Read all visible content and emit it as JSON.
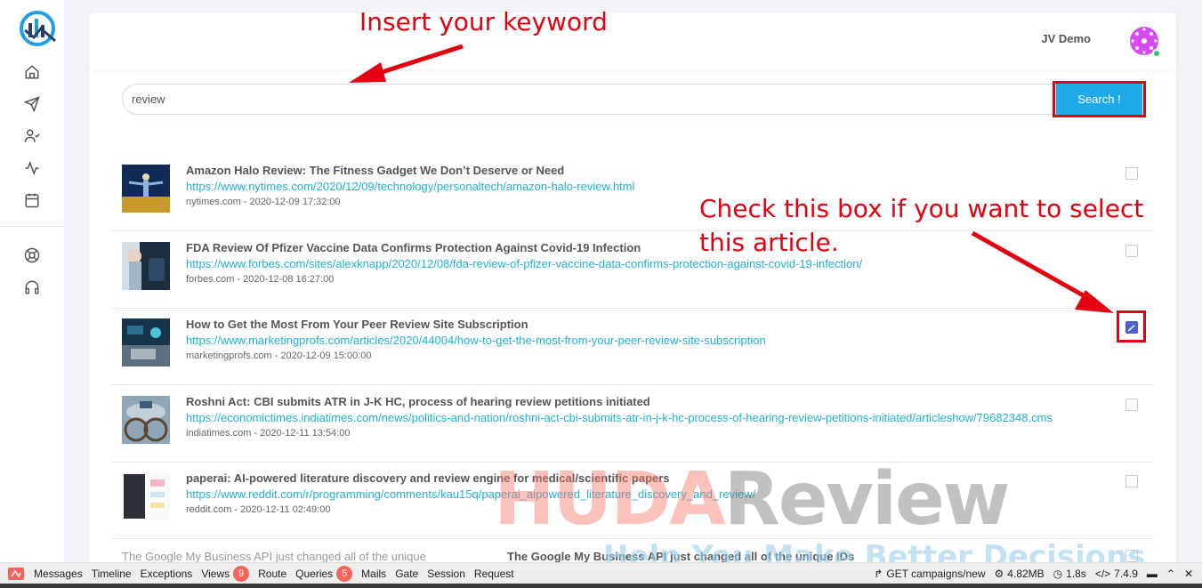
{
  "header": {
    "user_name": "JV Demo"
  },
  "search": {
    "value": "review",
    "button_label": "Search !"
  },
  "results": [
    {
      "title": "Amazon Halo Review: The Fitness Gadget We Don’t Deserve or Need",
      "url": "https://www.nytimes.com/2020/12/09/technology/personaltech/amazon-halo-review.html",
      "meta": "nytimes.com - 2020-12-09 17:32:00",
      "checked": false
    },
    {
      "title": "FDA Review Of Pfizer Vaccine Data Confirms Protection Against Covid-19 Infection",
      "url": "https://www.forbes.com/sites/alexknapp/2020/12/08/fda-review-of-pfizer-vaccine-data-confirms-protection-against-covid-19-infection/",
      "meta": "forbes.com - 2020-12-08 16:27:00",
      "checked": false
    },
    {
      "title": "How to Get the Most From Your Peer Review Site Subscription",
      "url": "https://www.marketingprofs.com/articles/2020/44004/how-to-get-the-most-from-your-peer-review-site-subscription",
      "meta": "marketingprofs.com - 2020-12-09 15:00:00",
      "checked": true
    },
    {
      "title": "Roshni Act: CBI submits ATR in J-K HC, process of hearing review petitions initiated",
      "url": "https://economictimes.indiatimes.com/news/politics-and-nation/roshni-act-cbi-submits-atr-in-j-k-hc-process-of-hearing-review-petitions-initiated/articleshow/79682348.cms",
      "meta": "indiatimes.com - 2020-12-11 13:54:00",
      "checked": false
    },
    {
      "title": "paperai: AI-powered literature discovery and review engine for medical/scientific papers",
      "url": "https://www.reddit.com/r/programming/comments/kau15q/paperai_aipowered_literature_discovery_and_review/",
      "meta": "reddit.com - 2020-12-11 02:49:00",
      "checked": false
    }
  ],
  "partial_result": {
    "image_alt": "The Google My Business API just changed all of the unique",
    "title": "The Google My Business API just changed all of the unique IDs"
  },
  "annotations": {
    "keyword": "Insert your keyword",
    "checkbox_line1": "Check this box if you want to select",
    "checkbox_line2": "this article."
  },
  "watermark": {
    "part1": "HUDA",
    "part2": "Review",
    "tagline": "Help You Make Better Decisions"
  },
  "debugbar": {
    "items": [
      {
        "label": "Messages"
      },
      {
        "label": "Timeline"
      },
      {
        "label": "Exceptions"
      },
      {
        "label": "Views",
        "badge": "9"
      },
      {
        "label": "Route"
      },
      {
        "label": "Queries",
        "badge": "5"
      },
      {
        "label": "Mails"
      },
      {
        "label": "Gate"
      },
      {
        "label": "Session"
      },
      {
        "label": "Request"
      }
    ],
    "route": "GET campaigns/new",
    "memory": "4.82MB",
    "time": "1.8s",
    "php_version": "7.4.9"
  },
  "colors": {
    "accent": "#1eaae8",
    "link": "#1fb1d6",
    "annotation": "#e3000f",
    "badge": "#f4645f"
  }
}
